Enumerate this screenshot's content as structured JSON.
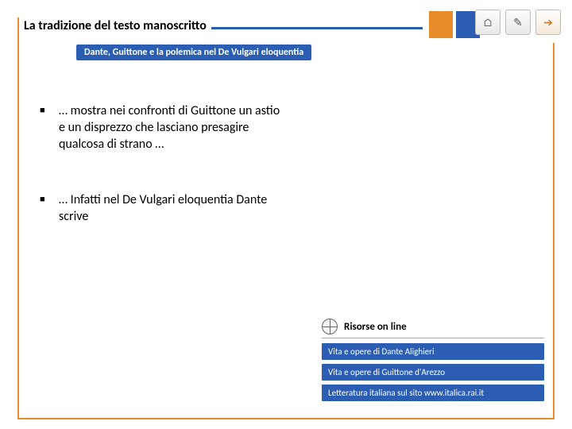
{
  "header": {
    "title": "La tradizione del testo manoscritto",
    "subtitle": "Dante, Guittone e la polemica nel De Vulgari eloquentia"
  },
  "blocks": {
    "orange": "#e78b2b",
    "blue": "#2b5db3",
    "white": "#ffffff"
  },
  "bullets": [
    "… mostra nei confronti di Guittone un astio e un disprezzo che lasciano presagire qualcosa di strano …",
    "… Infatti nel De Vulgari eloquentia Dante scrive"
  ],
  "resources": {
    "heading": "Risorse on line",
    "links": [
      "Vita e opere di Dante Alighieri",
      "Vita e opere di Guittone d'Arezzo",
      "Letteratura italiana sul sito www.italica.rai.it"
    ]
  },
  "icons": {
    "home": "⌂",
    "note": "✎",
    "arrow": "➔"
  }
}
